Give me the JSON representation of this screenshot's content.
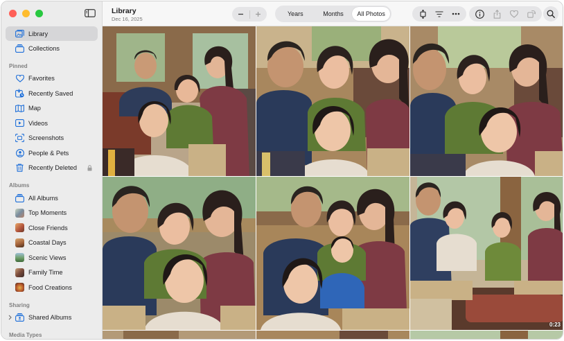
{
  "window": {
    "title": "Library",
    "date": "Dec 16, 2025"
  },
  "sidebar": {
    "top_items": [
      {
        "label": "Library",
        "icon": "library-icon",
        "active": true
      },
      {
        "label": "Collections",
        "icon": "collections-icon"
      }
    ],
    "sections": [
      {
        "title": "Pinned",
        "items": [
          {
            "label": "Favorites",
            "icon": "heart-icon"
          },
          {
            "label": "Recently Saved",
            "icon": "recently-saved-icon"
          },
          {
            "label": "Map",
            "icon": "map-icon"
          },
          {
            "label": "Videos",
            "icon": "video-icon"
          },
          {
            "label": "Screenshots",
            "icon": "screenshot-icon"
          },
          {
            "label": "People & Pets",
            "icon": "people-icon"
          },
          {
            "label": "Recently Deleted",
            "icon": "trash-icon",
            "locked": true
          }
        ]
      },
      {
        "title": "Albums",
        "items": [
          {
            "label": "All Albums",
            "icon": "albums-icon"
          },
          {
            "label": "Top Moments",
            "icon": "album-thumb-icon"
          },
          {
            "label": "Close Friends",
            "icon": "album-thumb-icon"
          },
          {
            "label": "Coastal Days",
            "icon": "album-thumb-icon"
          },
          {
            "label": "Scenic Views",
            "icon": "album-thumb-icon"
          },
          {
            "label": "Family Time",
            "icon": "album-thumb-icon"
          },
          {
            "label": "Food Creations",
            "icon": "album-thumb-icon"
          }
        ]
      },
      {
        "title": "Sharing",
        "items": [
          {
            "label": "Shared Albums",
            "icon": "shared-albums-icon"
          }
        ]
      },
      {
        "title": "Media Types",
        "items": []
      }
    ]
  },
  "toolbar": {
    "segments": [
      "Years",
      "Months",
      "All Photos"
    ],
    "selected_segment": "All Photos"
  },
  "photos": [
    {
      "kind": "photo"
    },
    {
      "kind": "photo"
    },
    {
      "kind": "photo"
    },
    {
      "kind": "photo"
    },
    {
      "kind": "photo"
    },
    {
      "kind": "video",
      "duration": "0:23"
    }
  ],
  "colors": {
    "accent": "#1e6fd9",
    "sidebar_bg": "#ececec",
    "close": "#ff5f57",
    "minimize": "#febc2e",
    "maximize": "#28c840"
  }
}
